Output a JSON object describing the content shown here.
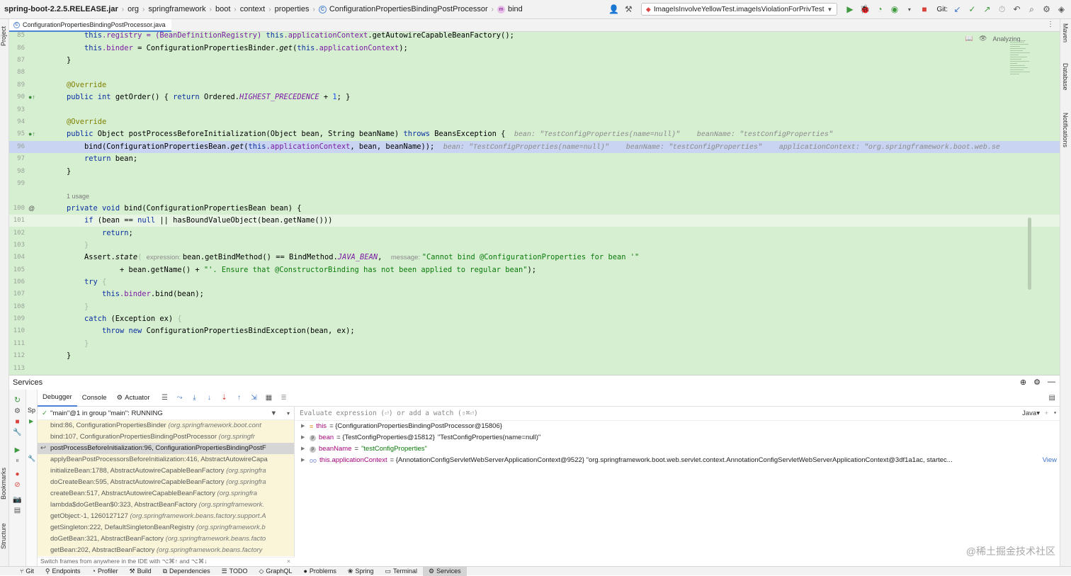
{
  "breadcrumb": {
    "items": [
      "spring-boot-2.2.5.RELEASE.jar",
      "org",
      "springframework",
      "boot",
      "context",
      "properties",
      "ConfigurationPropertiesBindingPostProcessor",
      "bind"
    ]
  },
  "toolbar": {
    "run_config": "ImageIsInvolveYellowTest.imageIsViolationForPrivTest",
    "git_label": "Git:"
  },
  "left_strip": {
    "project": "Project",
    "bookmarks": "Bookmarks",
    "structure": "Structure"
  },
  "right_strip": {
    "maven": "Maven",
    "database": "Database",
    "notifications": "Notifications"
  },
  "editor": {
    "file_tab": "ConfigurationPropertiesBindingPostProcessor.java",
    "status": "Analyzing...",
    "line_numbers": [
      "85",
      "86",
      "87",
      "88",
      "89",
      "90",
      "93",
      "94",
      "95",
      "96",
      "97",
      "98",
      "99",
      "100",
      "101",
      "102",
      "103",
      "104",
      "105",
      "106",
      "107",
      "108",
      "109",
      "110",
      "111",
      "112",
      "113"
    ],
    "usage_hint": "1 usage",
    "code": {
      "l85a": "this",
      "l85b": ".registry = (BeanDefinitionRegistry) ",
      "l85c": "this",
      "l85d": ".applicationContext",
      "l85e": ".getAutowireCapableBeanFactory();",
      "l86a": "this",
      "l86b": ".binder",
      "l86c": " = ConfigurationPropertiesBinder.",
      "l86d": "get",
      "l86e": "(",
      "l86f": "this",
      "l86g": ".applicationContext",
      "l86h": ");",
      "l87": "}",
      "l89": "@Override",
      "l90a": "public int ",
      "l90b": "getOrder() { ",
      "l90c": "return ",
      "l90d": "Ordered.",
      "l90e": "HIGHEST_PRECEDENCE",
      "l90f": " + ",
      "l90g": "1",
      "l90h": "; }",
      "l94": "@Override",
      "l95a": "public ",
      "l95b": "Object postProcessBeforeInitialization(Object bean, String beanName) ",
      "l95c": "throws ",
      "l95d": "BeansException {",
      "l95hint": "bean: \"TestConfigProperties(name=null)\"    beanName: \"testConfigProperties\"",
      "l96a": "bind(ConfigurationPropertiesBean.",
      "l96b": "get",
      "l96c": "(",
      "l96d": "this",
      "l96e": ".applicationContext",
      "l96f": ", bean, beanName));",
      "l96hint": "bean: \"TestConfigProperties(name=null)\"    beanName: \"testConfigProperties\"    applicationContext: \"org.springframework.boot.web.se",
      "l97a": "return ",
      "l97b": "bean;",
      "l98": "}",
      "l100a": "private void ",
      "l100b": "bind(ConfigurationPropertiesBean bean) {",
      "l101a": "if ",
      "l101b": "(bean == ",
      "l101c": "null ",
      "l101d": "|| hasBoundValueObject(bean.getName()))",
      "l102a": "return",
      "l102b": ";",
      "l103": "}",
      "l104a": "Assert.",
      "l104b": "state",
      "l104c": "( ",
      "l104d": "expression: ",
      "l104e": "bean.getBindMethod() == BindMethod.",
      "l104f": "JAVA_BEAN",
      "l104g": ",  ",
      "l104h": "message: ",
      "l104i": "\"Cannot bind @ConfigurationProperties for bean '\"",
      "l105a": "+ bean.getName() + ",
      "l105b": "\"'. Ensure that @ConstructorBinding has not been applied to regular bean\"",
      "l105c": ");",
      "l106a": "try",
      "l106b": " {",
      "l107a": "this",
      "l107b": ".binder",
      "l107c": ".bind(bean);",
      "l108": "}",
      "l109a": "catch ",
      "l109b": "(Exception ex) ",
      "l109c": "{",
      "l110a": "throw new ",
      "l110b": "ConfigurationPropertiesBindException(bean, ex);",
      "l111": "}",
      "l112": "}"
    }
  },
  "services": {
    "title": "Services",
    "tree_label": "Sp",
    "tabs": [
      "Debugger",
      "Console",
      "Actuator"
    ],
    "thread": "\"main\"@1 in group \"main\": RUNNING",
    "frames": [
      {
        "method": "bind:86, ConfigurationPropertiesBinder ",
        "pkg": "(org.springframework.boot.cont"
      },
      {
        "method": "bind:107, ConfigurationPropertiesBindingPostProcessor ",
        "pkg": "(org.springfr"
      },
      {
        "method": "postProcessBeforeInitialization:96, ConfigurationPropertiesBindingPostF",
        "pkg": ""
      },
      {
        "method": "applyBeanPostProcessorsBeforeInitialization:416, AbstractAutowireCapa",
        "pkg": ""
      },
      {
        "method": "initializeBean:1788, AbstractAutowireCapableBeanFactory ",
        "pkg": "(org.springfra"
      },
      {
        "method": "doCreateBean:595, AbstractAutowireCapableBeanFactory ",
        "pkg": "(org.springfra"
      },
      {
        "method": "createBean:517, AbstractAutowireCapableBeanFactory ",
        "pkg": "(org.springfra"
      },
      {
        "method": "lambda$doGetBean$0:323, AbstractBeanFactory ",
        "pkg": "(org.springframework."
      },
      {
        "method": "getObject:-1, 1260127127 ",
        "pkg": "(org.springframework.beans.factory.support.A"
      },
      {
        "method": "getSingleton:222, DefaultSingletonBeanRegistry ",
        "pkg": "(org.springframework.b"
      },
      {
        "method": "doGetBean:321, AbstractBeanFactory ",
        "pkg": "(org.springframework.beans.facto"
      },
      {
        "method": "getBean:202, AbstractBeanFactory ",
        "pkg": "(org.springframework.beans.factory"
      }
    ],
    "switch_hint": "Switch frames from anywhere in the IDE with ⌥⌘↑ and ⌥⌘↓",
    "eval_placeholder": "Evaluate expression (⏎) or add a watch (⇧⌘⏎)",
    "language": "Java",
    "variables": [
      {
        "badge": "",
        "name": "this",
        "value": " = {ConfigurationPropertiesBindingPostProcessor@15806}",
        "str": ""
      },
      {
        "badge": "p",
        "name": "bean",
        "value": " = {TestConfigProperties@15812} ",
        "str": "\"TestConfigProperties(name=null)\""
      },
      {
        "badge": "p",
        "name": "beanName",
        "value": " = ",
        "str": "\"testConfigProperties\""
      },
      {
        "badge": "oo",
        "name": "this.applicationContext",
        "value": " = {AnnotationConfigServletWebServerApplicationContext@9522} \"org.springframework.boot.web.servlet.context.AnnotationConfigServletWebServerApplicationContext@3df1a1ac, startec...",
        "str": ""
      }
    ],
    "view_link": "View"
  },
  "bottom_tabs": [
    "Git",
    "Endpoints",
    "Profiler",
    "Build",
    "Dependencies",
    "TODO",
    "GraphQL",
    "Problems",
    "Spring",
    "Terminal",
    "Services"
  ],
  "watermark": "@稀土掘金技术社区"
}
